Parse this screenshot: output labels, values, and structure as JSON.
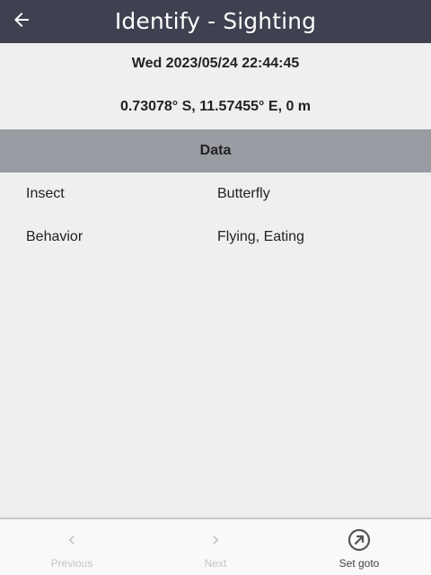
{
  "header": {
    "title": "Identify - Sighting",
    "back_icon": "arrow-left-icon"
  },
  "record": {
    "datetime": "Wed 2023/05/24 22:44:45",
    "location": "0.73078° S, 11.57455° E, 0 m"
  },
  "data_section": {
    "title": "Data",
    "fields": [
      {
        "label": "Insect",
        "value": "Butterfly"
      },
      {
        "label": "Behavior",
        "value": "Flying, Eating"
      }
    ]
  },
  "bottom_nav": {
    "previous": {
      "label": "Previous",
      "icon": "chevron-left-icon",
      "enabled": false
    },
    "next": {
      "label": "Next",
      "icon": "chevron-right-icon",
      "enabled": false
    },
    "set_goto": {
      "label": "Set goto",
      "icon": "circle-arrow-up-right-icon",
      "enabled": true
    }
  },
  "colors": {
    "appbar": "#3f4150",
    "section_header": "#9a9ca3",
    "background": "#efefef"
  }
}
